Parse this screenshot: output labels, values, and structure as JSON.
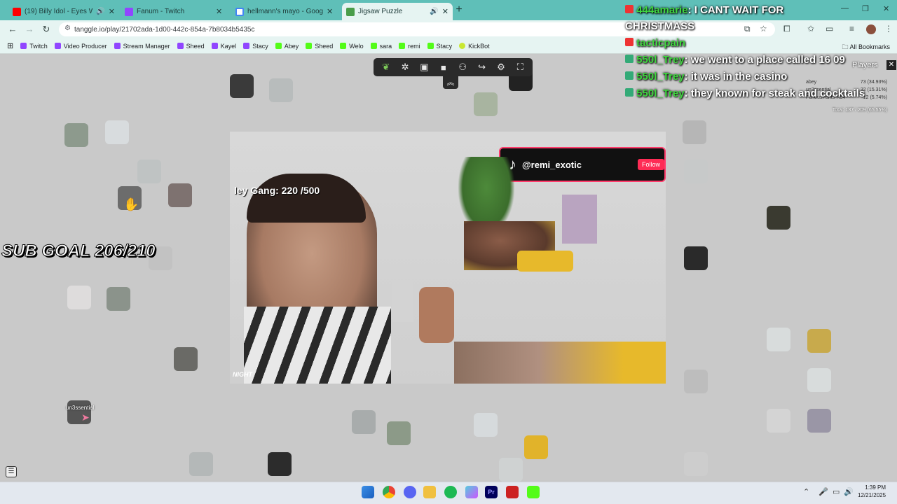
{
  "tabs": [
    {
      "title": "(19) Billy Idol - Eyes Without",
      "active": false,
      "has_audio": true
    },
    {
      "title": "Fanum - Twitch",
      "active": false,
      "has_audio": false
    },
    {
      "title": "hellmann's mayo - Google Sear",
      "active": false,
      "has_audio": false
    },
    {
      "title": "Jigsaw Puzzle",
      "active": true,
      "has_audio": true
    }
  ],
  "address": {
    "url": "tanggle.io/play/21702ada-1d00-442c-854a-7b8034b5435c"
  },
  "bookmarks": [
    "Twitch",
    "Video Producer",
    "Stream Manager",
    "Sheed",
    "Kayel",
    "Stacy",
    "Abey",
    "Sheed",
    "Welo",
    "sara",
    "remi",
    "Stacy",
    "KickBot"
  ],
  "all_bookmarks_label": "All Bookmarks",
  "overlay": {
    "chat": [
      {
        "user": "444amarie",
        "text": "I CANT WAIT FOR"
      },
      {
        "user": "",
        "text": "CHRISTMASS"
      },
      {
        "user": "tacticpain",
        "text": ""
      },
      {
        "user": "550l_Trey",
        "text": "we went to a place called 16 09"
      },
      {
        "user": "550l_Trey",
        "text": "it was in the casino"
      },
      {
        "user": "550l_Trey",
        "text": "they known for steak and cocktails"
      }
    ],
    "sub_goal": "SUB GOAL 206/210",
    "tiktok_handle": "@remi_exotic",
    "tiktok_follow": "Follow",
    "gang_counter": "ley Gang: 220  /500",
    "cursor_label": "un3ssential",
    "watermark": "NIGHT"
  },
  "players_panel": {
    "title": "Players",
    "rows": [
      {
        "name": "abey",
        "score": "73 (34.93%)"
      },
      {
        "name": "un3ssential",
        "score": "32 (15.31%)"
      },
      {
        "name": "FuriousPants-R54",
        "score": "12 (5.74%)"
      }
    ],
    "total": "Total: 137 / 209 (65.55%)"
  },
  "taskbar": {
    "time": "1:39 PM",
    "date": "12/21/2025"
  },
  "colors": {
    "tabstrip": "#5fbfb8",
    "chrome": "#e6f4f2",
    "chat_user": "#3fd63f"
  }
}
